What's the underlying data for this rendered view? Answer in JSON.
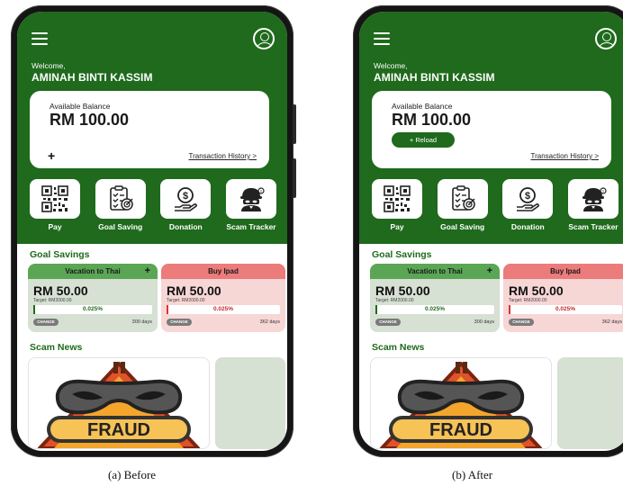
{
  "panels": [
    {
      "caption": "(a) Before",
      "welcome": "Welcome,",
      "user_name": "AMINAH BINTI KASSIM",
      "balance_label": "Available Balance",
      "balance_amount": "RM 100.00",
      "add_glyph": "+",
      "history_link": "Transaction History >",
      "services": [
        "Pay",
        "Goal Saving",
        "Donation",
        "Scam Tracker"
      ],
      "goal_section_title": "Goal Savings",
      "goals": [
        {
          "name": "Vacation to Thai",
          "add_glyph": "+",
          "amount": "RM 50.00",
          "target": "Target: RM2000.00",
          "percent_label": "0.025%",
          "progress": 0.025,
          "change_label": "CHANGE",
          "days": "300 days"
        },
        {
          "name": "Buy Ipad",
          "amount": "RM 50.00",
          "target": "Target: RM2000.00",
          "percent_label": "0.025%",
          "progress": 0.025,
          "change_label": "CHANGE",
          "days": "362 days"
        }
      ],
      "news_section_title": "Scam News",
      "news_image_text": "FRAUD"
    },
    {
      "caption": "(b) After",
      "welcome": "Welcome,",
      "user_name": "AMINAH BINTI KASSIM",
      "balance_label": "Available Balance",
      "balance_amount": "RM 100.00",
      "reload_label": "+ Reload",
      "history_link": "Transaction History >",
      "services": [
        "Pay",
        "Goal Saving",
        "Donation",
        "Scam Tracker"
      ],
      "goal_section_title": "Goal Savings",
      "goals": [
        {
          "name": "Vacation to Thai",
          "add_glyph": "+",
          "amount": "RM 50.00",
          "target": "Target: RM2000.00",
          "percent_label": "0.025%",
          "progress": 0.025,
          "change_label": "CHANGE",
          "days": "300 days"
        },
        {
          "name": "Buy Ipad",
          "amount": "RM 50.00",
          "target": "Target: RM2000.00",
          "percent_label": "0.025%",
          "progress": 0.025,
          "change_label": "CHANGE",
          "days": "362 days"
        }
      ],
      "news_section_title": "Scam News",
      "news_image_text": "FRAUD"
    }
  ],
  "colors": {
    "primary_green": "#1f6a1c",
    "goal_green_header": "#5aa655",
    "goal_green_bg": "#d6e0d3",
    "goal_red_header": "#ec7b7b",
    "goal_red_bg": "#f7d6d6",
    "fraud_orange": "#f4a52b",
    "fraud_red": "#e0532a"
  },
  "icons": {
    "menu": "hamburger-menu-icon",
    "profile": "user-profile-icon",
    "pay": "qr-code-icon",
    "goal_saving": "target-checklist-icon",
    "donation": "coin-hand-icon",
    "scam_tracker": "masked-thief-icon",
    "news_image": "fraud-warning-image"
  }
}
